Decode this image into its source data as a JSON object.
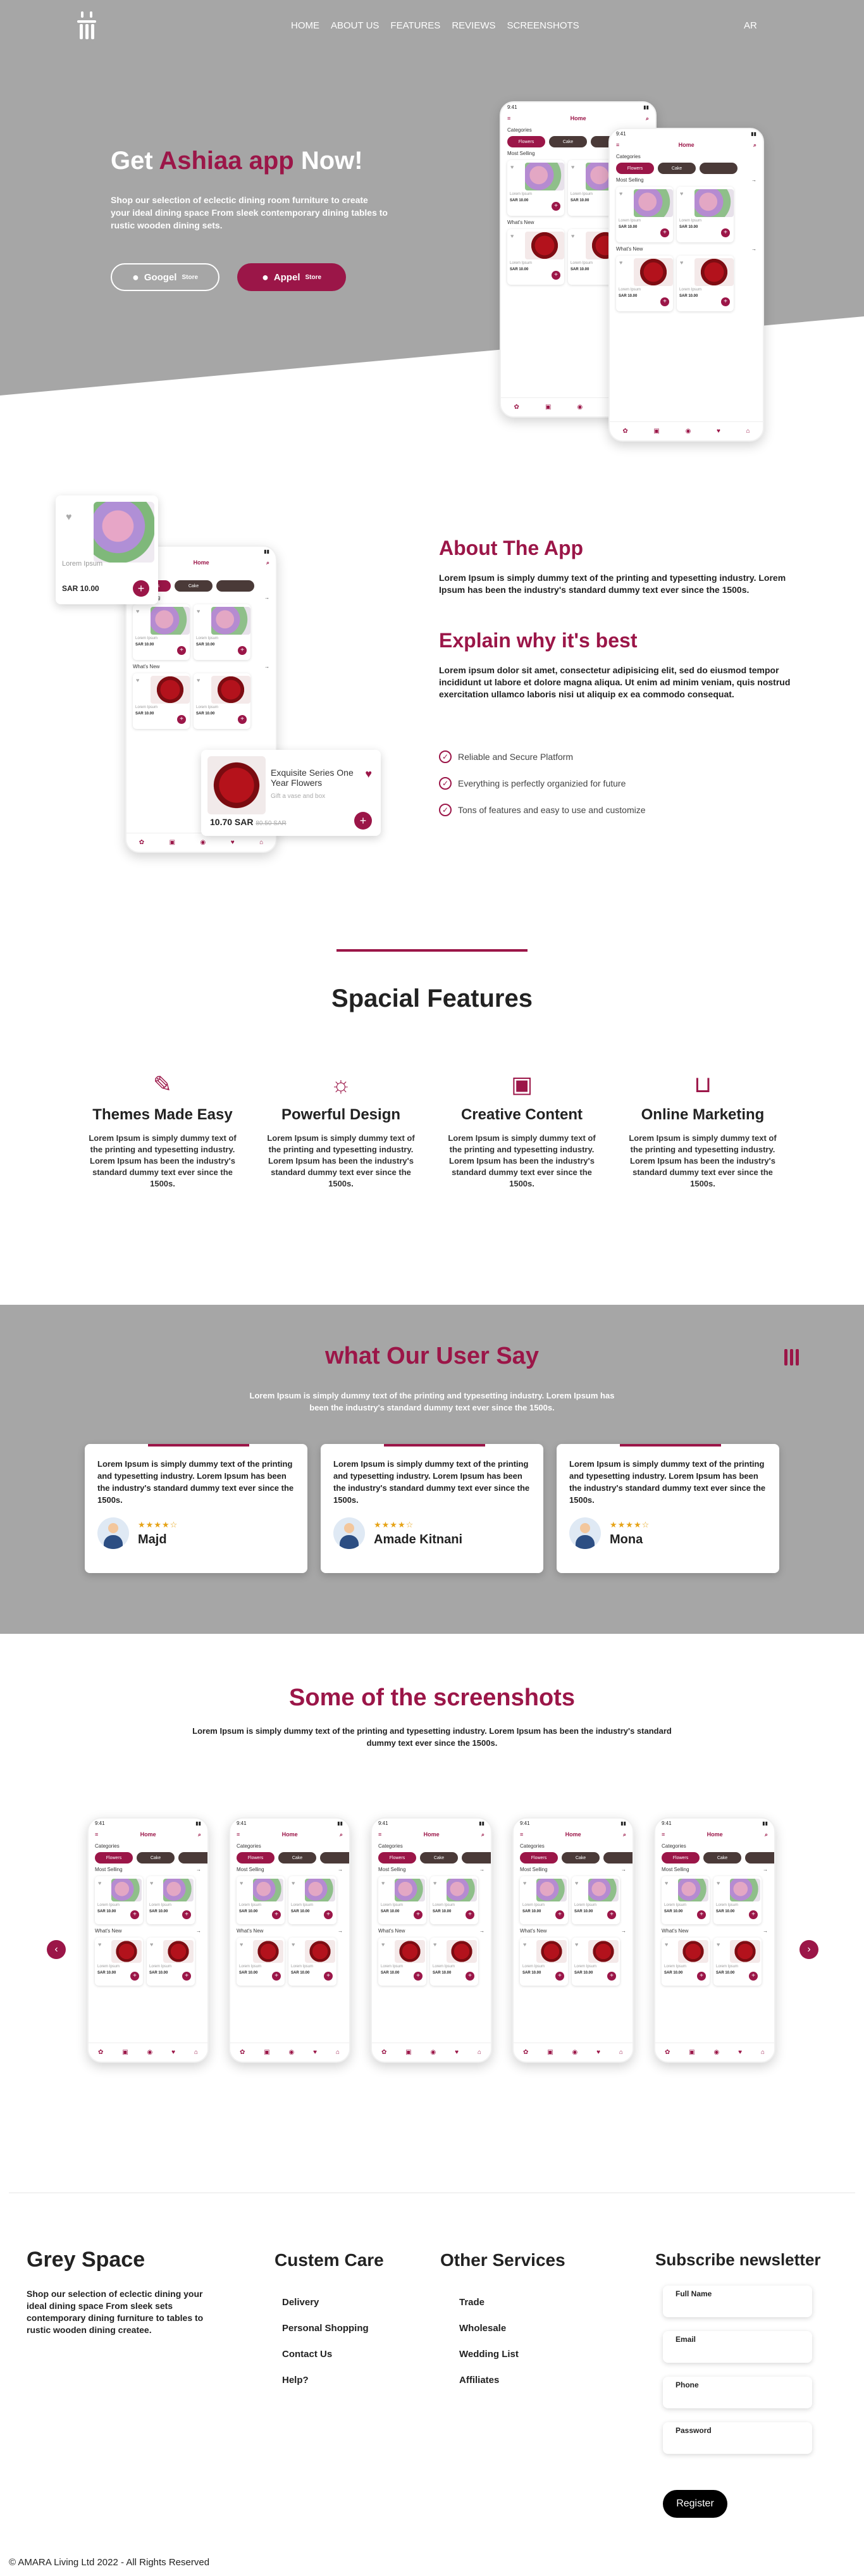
{
  "nav": {
    "links": [
      "HOME",
      "ABOUT US",
      "FEATURES",
      "REVIEWS",
      "SCREENSHOTS"
    ],
    "lang": "AR"
  },
  "hero": {
    "title_pre": "Get ",
    "title_accent": "Ashiaa app",
    "title_post": " Now!",
    "description": "Shop our selection of eclectic dining room furniture to create your ideal dining space From sleek contemporary dining tables to rustic wooden dining sets.",
    "google_label": "Googel",
    "google_small": "Store",
    "apple_label": "Appel",
    "apple_small": "Store"
  },
  "phone": {
    "time": "9:41",
    "header": "Home",
    "categories": "Categories",
    "pill_1": "Flowers",
    "pill_2": "Cake",
    "most_selling": "Most Selling",
    "whats_new": "What's New",
    "card_title": "Lorem Ipsum",
    "card_price": "SAR 10.00",
    "bottom_note": "Exquisite Series One"
  },
  "about": {
    "title": "About The App",
    "text": "Lorem Ipsum is simply dummy text of the printing and typesetting industry. Lorem Ipsum has been the industry's standard dummy text ever since the 1500s.",
    "title2": "Explain why it's best",
    "text2": "Lorem ipsum dolor sit amet, consectetur adipisicing elit, sed do eiusmod tempor incididunt ut labore et dolore magna aliqua. Ut enim ad minim veniam, quis nostrud exercitation ullamco laboris nisi ut aliquip ex ea commodo consequat.",
    "checks": [
      "Reliable and Secure Platform",
      "Everything is perfectly organizied for future",
      "Tons of features and easy to use and customize"
    ],
    "float1": {
      "title": "Lorem Ipsum",
      "price": "SAR 10.00"
    },
    "float2": {
      "title": "Exquisite Series One Year Flowers",
      "subtitle": "Gift a vase and box",
      "price": "10.70 SAR",
      "old_price": "80.50 SAR"
    }
  },
  "features": {
    "title": "Spacial Features",
    "items": [
      {
        "title": "Themes Made Easy",
        "text": "Lorem Ipsum is simply dummy text of the printing and typesetting industry. Lorem Ipsum has been the industry's standard dummy text ever since the 1500s.",
        "icon": "brush-icon"
      },
      {
        "title": "Powerful Design",
        "text": "Lorem Ipsum is simply dummy text of the printing and typesetting industry. Lorem Ipsum has been the industry's standard dummy text ever since the 1500s.",
        "icon": "sun-gear-icon"
      },
      {
        "title": "Creative Content",
        "text": "Lorem Ipsum is simply dummy text of the printing and typesetting industry. Lorem Ipsum has been the industry's standard dummy text ever since the 1500s.",
        "icon": "frame-icon"
      },
      {
        "title": "Online Marketing",
        "text": "Lorem Ipsum is simply dummy text of the printing and typesetting industry. Lorem Ipsum has been the industry's standard dummy text ever since the 1500s.",
        "icon": "cart-icon"
      }
    ]
  },
  "testimonials": {
    "title": "what Our User Say",
    "subtitle": "Lorem Ipsum is simply dummy text of the printing and typesetting industry. Lorem Ipsum has been the industry's standard dummy text ever since the 1500s.",
    "stars": "★★★★☆",
    "items": [
      {
        "text": "Lorem Ipsum is simply dummy text of the printing and typesetting industry. Lorem Ipsum has been the industry's standard dummy text ever since the 1500s.",
        "name": "Majd"
      },
      {
        "text": "Lorem Ipsum is simply dummy text of the printing and typesetting industry. Lorem Ipsum has been the industry's standard dummy text ever since the 1500s.",
        "name": "Amade Kitnani"
      },
      {
        "text": "Lorem Ipsum is simply dummy text of the printing and typesetting industry. Lorem Ipsum has been the industry's standard dummy text ever since the 1500s.",
        "name": "Mona"
      }
    ]
  },
  "screenshots": {
    "title": "Some of the screenshots",
    "subtitle": "Lorem Ipsum is simply dummy text of the printing and typesetting industry. Lorem Ipsum has been the industry's standard dummy text ever since the 1500s.",
    "prev": "‹",
    "next": "›"
  },
  "footer": {
    "brand": "Grey Space",
    "description": "Shop our selection of eclectic dining your ideal dining space From sleek sets contemporary dining furniture to tables to rustic wooden dining createe.",
    "care_title": "Custem Care",
    "care_links": [
      "Delivery",
      "Personal Shopping",
      "Contact Us",
      "Help?"
    ],
    "services_title": "Other Services",
    "services_links": [
      "Trade",
      "Wholesale",
      "Wedding List",
      "Affiliates"
    ],
    "newsletter_title": "Subscribe newsletter",
    "fields": [
      "Full Name",
      "Email",
      "Phone",
      "Password"
    ],
    "register": "Register",
    "copyright": "© AMARA Living Ltd 2022 - All Rights Reserved"
  },
  "colors": {
    "brand": "#9b1648",
    "gray": "#a6a6a6"
  }
}
